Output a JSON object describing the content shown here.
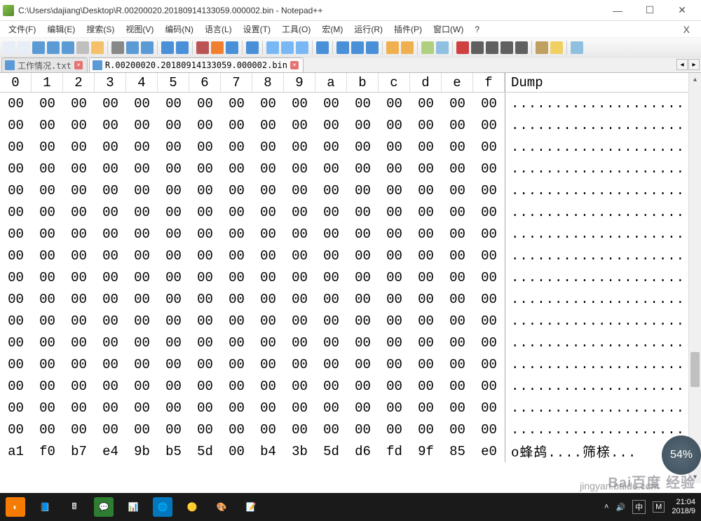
{
  "title": "C:\\Users\\dajiang\\Desktop\\R.00200020.20180914133059.000002.bin - Notepad++",
  "menus": [
    "文件(F)",
    "编辑(E)",
    "搜索(S)",
    "视图(V)",
    "编码(N)",
    "语言(L)",
    "设置(T)",
    "工具(O)",
    "宏(M)",
    "运行(R)",
    "插件(P)",
    "窗口(W)",
    "?"
  ],
  "tabs": [
    {
      "label": "工作情况.txt",
      "active": false
    },
    {
      "label": "R.00200020.20180914133059.000002.bin",
      "active": true
    }
  ],
  "hex": {
    "headers": [
      "0",
      "1",
      "2",
      "3",
      "4",
      "5",
      "6",
      "7",
      "8",
      "9",
      "a",
      "b",
      "c",
      "d",
      "e",
      "f"
    ],
    "dump_header": "Dump",
    "zero_row": [
      "00",
      "00",
      "00",
      "00",
      "00",
      "00",
      "00",
      "00",
      "00",
      "00",
      "00",
      "00",
      "00",
      "00",
      "00",
      "00"
    ],
    "zero_dump": "....................",
    "last_row": [
      "a1",
      "f0",
      "b7",
      "e4",
      "9b",
      "b5",
      "5d",
      "00",
      "b4",
      "3b",
      "5d",
      "d6",
      "fd",
      "9f",
      "85",
      "e0"
    ],
    "last_dump": "o蜂鸪....筛榇...",
    "zero_row_count": 16
  },
  "watermark": {
    "pct": "54%",
    "site": "jingyan.baidu.com",
    "brand": "Bai百度 经验"
  },
  "tray": {
    "ime1": "中",
    "ime2": "M",
    "time": "21:04",
    "date": "2018/9"
  },
  "toolbar_colors": [
    "#e8eef6",
    "#e8eef6",
    "#5b9bd5",
    "#5b9bd5",
    "#5b9bd5",
    "#bfbfbf",
    "#f5c069",
    "sep",
    "#888",
    "#5b9bd5",
    "#5b9bd5",
    "sep",
    "#4a90d9",
    "#4a90d9",
    "sep",
    "#bb5555",
    "#f08030",
    "#4a90d9",
    "sep",
    "#4a90d9",
    "sep",
    "#7ab8f5",
    "#7ab8f5",
    "#7ab8f5",
    "sep",
    "#4a90d9",
    "sep",
    "#4a90d9",
    "#4a90d9",
    "#4a90d9",
    "sep",
    "#f0b050",
    "#f0b050",
    "sep",
    "#b0d080",
    "#90c0e0",
    "sep",
    "#d04040",
    "#606060",
    "#606060",
    "#606060",
    "#606060",
    "sep",
    "#c0a060",
    "#f0d060",
    "sep",
    "#90c0e0"
  ],
  "task_icons": [
    {
      "bg": "#f57c00",
      "sym": "◐"
    },
    {
      "bg": "#1a1a1a",
      "sym": "📘"
    },
    {
      "bg": "#1a1a1a",
      "sym": "🖩"
    },
    {
      "bg": "#2e7d32",
      "sym": "💬"
    },
    {
      "bg": "#1a1a1a",
      "sym": "📊"
    },
    {
      "bg": "#0277bd",
      "sym": "🌐"
    },
    {
      "bg": "#1a1a1a",
      "sym": "🟡"
    },
    {
      "bg": "#1a1a1a",
      "sym": "🎨"
    },
    {
      "bg": "#1a1a1a",
      "sym": "📝"
    }
  ]
}
